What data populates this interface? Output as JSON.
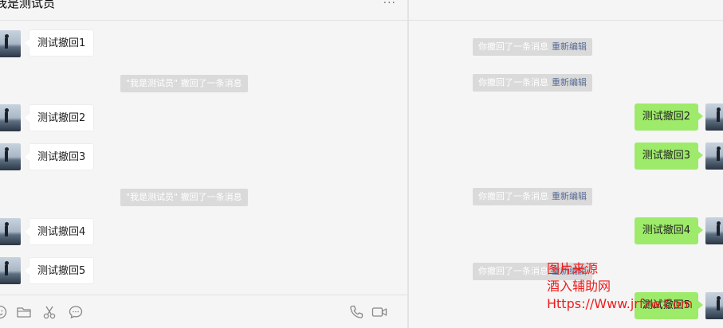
{
  "left": {
    "header": {
      "title": "我是测试员",
      "more_label": "···"
    },
    "messages": [
      {
        "type": "bubble",
        "text": "测试撤回1"
      },
      {
        "type": "notice",
        "text": "\"我是测试员\" 撤回了一条消息"
      },
      {
        "type": "bubble",
        "text": "测试撤回2"
      },
      {
        "type": "bubble",
        "text": "测试撤回3"
      },
      {
        "type": "notice",
        "text": "\"我是测试员\" 撤回了一条消息"
      },
      {
        "type": "bubble",
        "text": "测试撤回4"
      },
      {
        "type": "bubble",
        "text": "测试撤回5"
      }
    ],
    "toolbar": [
      "emoji-icon",
      "folder-icon",
      "scissors-icon",
      "chat-icon",
      "phone-icon",
      "video-icon"
    ]
  },
  "right": {
    "messages": [
      {
        "type": "notice",
        "text": "你撤回了一条消息",
        "action": "重新编辑"
      },
      {
        "type": "notice",
        "text": "你撤回了一条消息",
        "action": "重新编辑"
      },
      {
        "type": "bubble",
        "text": "测试撤回2"
      },
      {
        "type": "bubble",
        "text": "测试撤回3"
      },
      {
        "type": "notice",
        "text": "你撤回了一条消息",
        "action": "重新编辑"
      },
      {
        "type": "bubble",
        "text": "测试撤回4"
      },
      {
        "type": "notice",
        "text": "你撤回了一条消息",
        "action": "重新编辑"
      },
      {
        "type": "bubble",
        "text": "测试撤回5"
      }
    ]
  },
  "watermark": {
    "line1": "图片来源",
    "line2": "酒入辅助网",
    "line3": "Https://Www.jrfzw.Com"
  },
  "colors": {
    "background": "#f5f5f5",
    "sent_bubble": "#9eea6a",
    "received_bubble": "#ffffff",
    "notice_bg": "#dadada",
    "reedit_link": "#576b95",
    "watermark": "#ee1c1c"
  }
}
